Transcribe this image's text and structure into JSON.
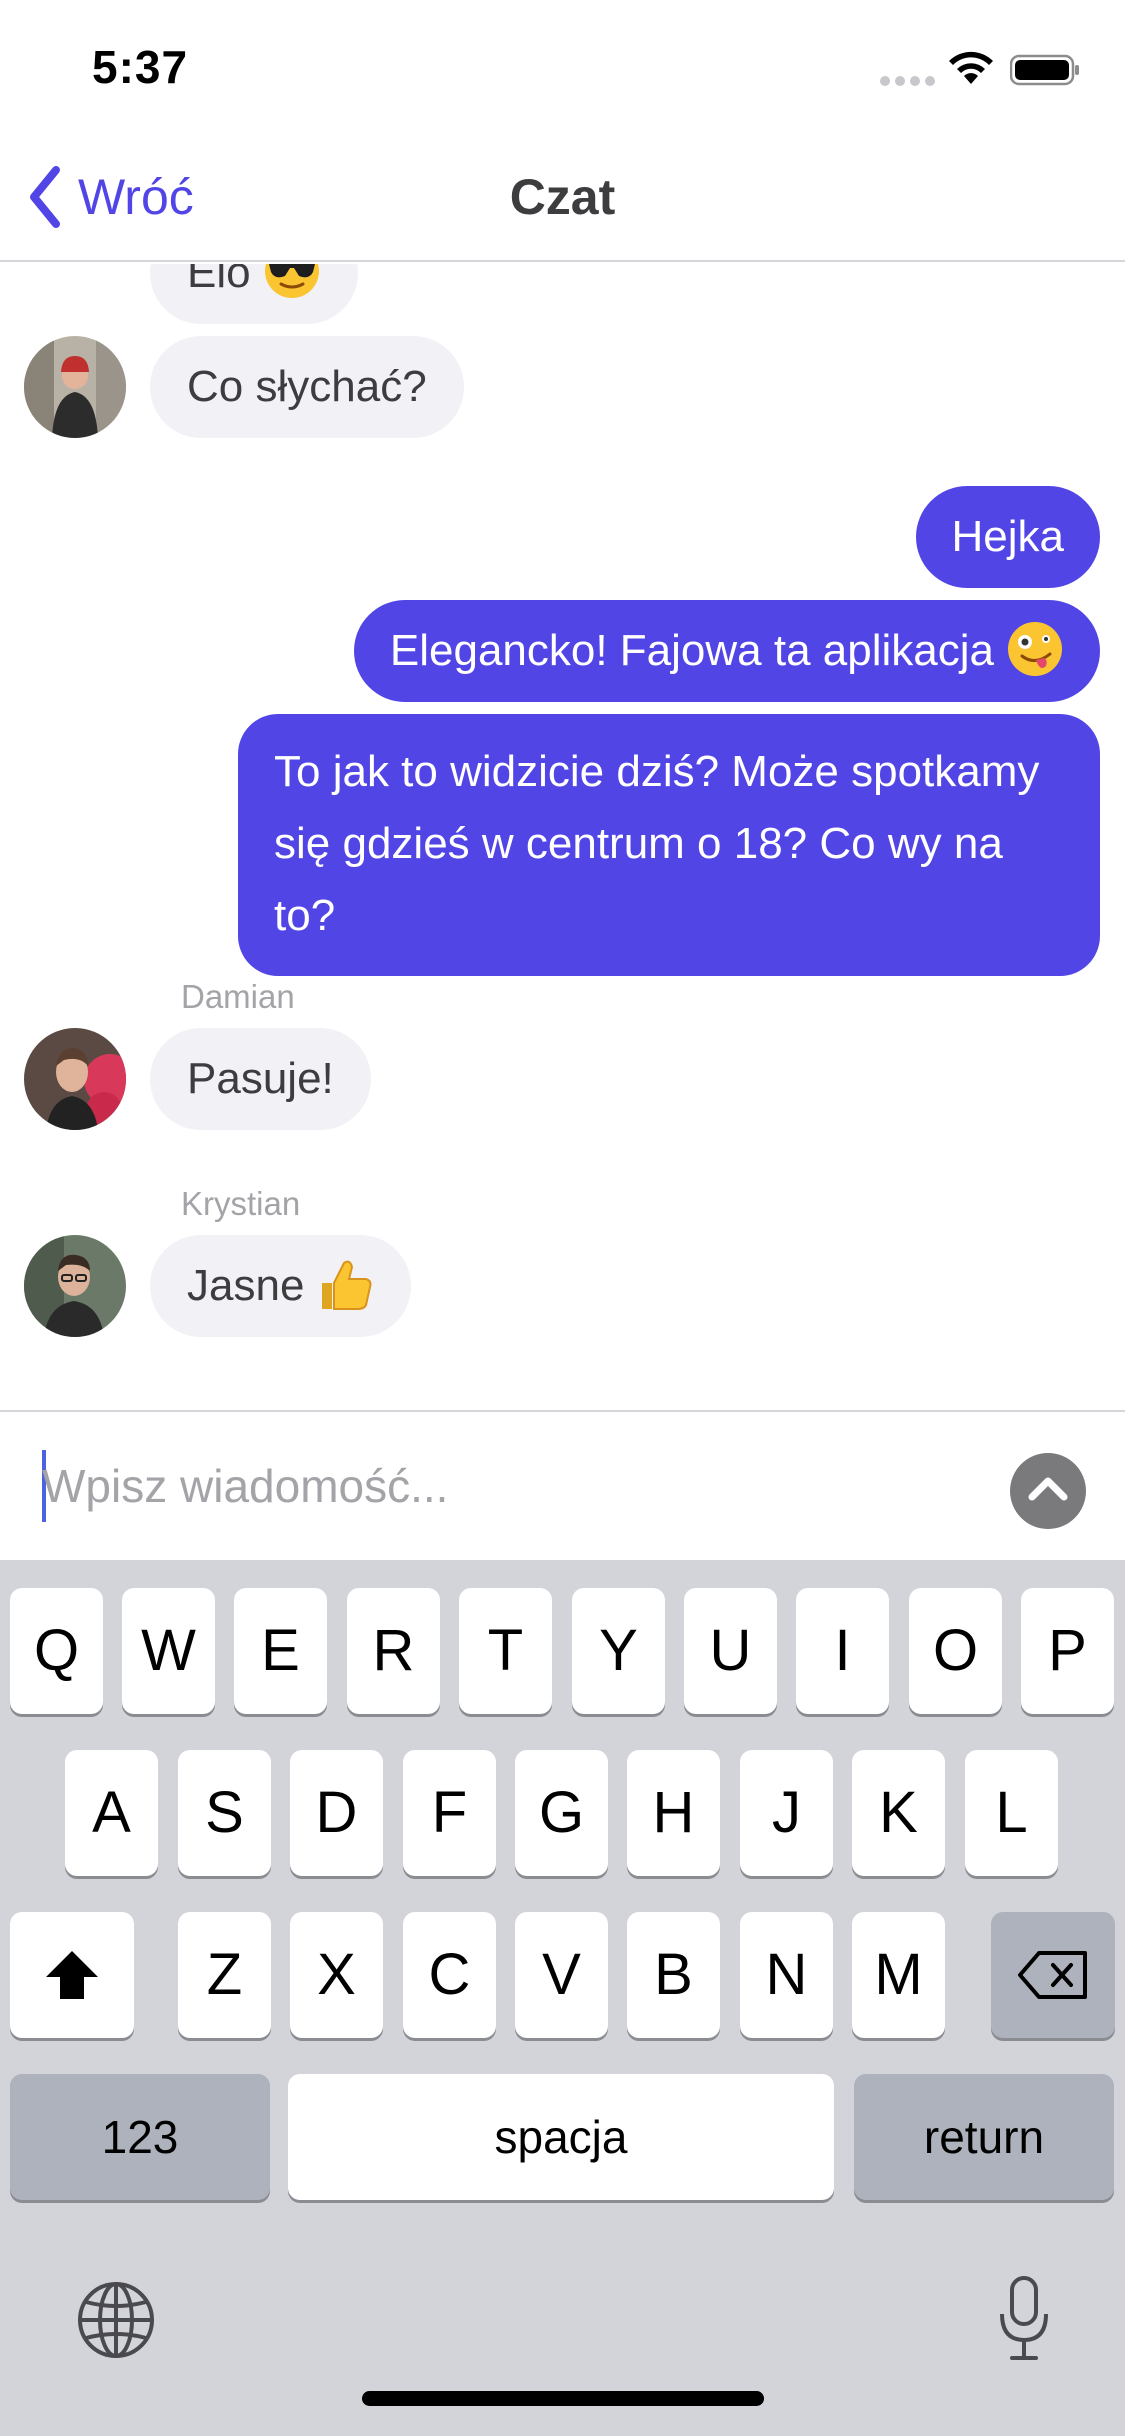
{
  "status_bar": {
    "time": "5:37"
  },
  "nav": {
    "back_label": "Wróć",
    "title": "Czat"
  },
  "messages": [
    {
      "from": "other",
      "text": "Elo",
      "emoji": "sunglasses"
    },
    {
      "from": "other",
      "text": "Co słychać?"
    },
    {
      "from": "me",
      "text": "Hejka"
    },
    {
      "from": "me",
      "text": "Elegancko! Fajowa ta aplikacja",
      "emoji": "zany-face"
    },
    {
      "from": "me",
      "text": "To jak to widzicie dziś? Może spotkamy się gdzieś w centrum o 18? Co wy na to?"
    },
    {
      "from": "other",
      "sender": "Damian",
      "text": "Pasuje!"
    },
    {
      "from": "other",
      "sender": "Krystian",
      "text": "Jasne",
      "emoji": "thumbs-up"
    }
  ],
  "composer": {
    "placeholder": "Wpisz wiadomość..."
  },
  "keyboard": {
    "row1": [
      "Q",
      "W",
      "E",
      "R",
      "T",
      "Y",
      "U",
      "I",
      "O",
      "P"
    ],
    "row2": [
      "A",
      "S",
      "D",
      "F",
      "G",
      "H",
      "J",
      "K",
      "L"
    ],
    "row3": [
      "Z",
      "X",
      "C",
      "V",
      "B",
      "N",
      "M"
    ],
    "numbers_label": "123",
    "space_label": "spacja",
    "return_label": "return"
  },
  "colors": {
    "accent": "#5245e6",
    "incoming_bubble": "#f1f1f6",
    "keyboard_bg": "#d2d4da"
  }
}
